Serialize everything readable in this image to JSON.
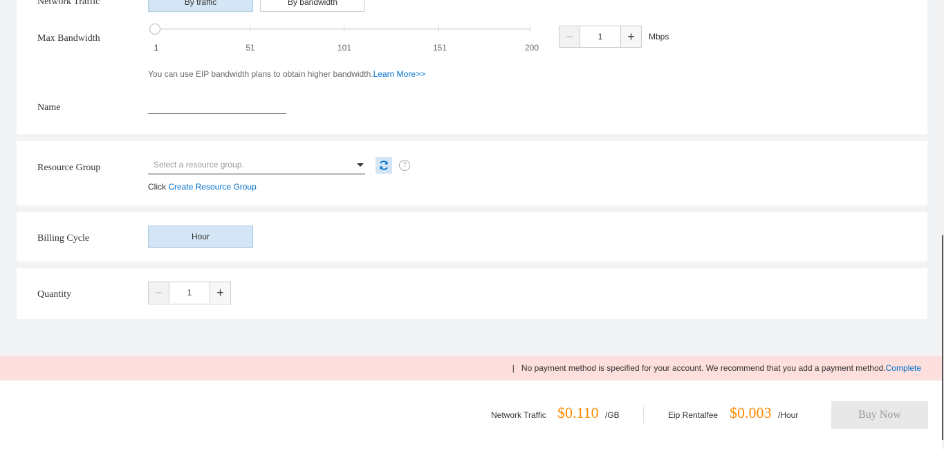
{
  "network": {
    "label": "Network Traffic",
    "options": [
      "By traffic",
      "By bandwidth"
    ]
  },
  "bandwidth": {
    "label": "Max Bandwidth",
    "ticks": [
      "1",
      "51",
      "101",
      "151",
      "200"
    ],
    "value": "1",
    "unit": "Mbps",
    "hint": "You can use EIP bandwidth plans to obtain higher bandwidth.",
    "learn_more": "Learn More>>"
  },
  "name": {
    "label": "Name",
    "value": ""
  },
  "resource_group": {
    "label": "Resource Group",
    "placeholder": "Select a resource group.",
    "click_text": "Click",
    "create_link": "Create Resource Group"
  },
  "billing": {
    "label": "Billing Cycle",
    "option": "Hour"
  },
  "quantity": {
    "label": "Quantity",
    "value": "1"
  },
  "notice": {
    "separator": "|",
    "text": "No payment method is specified for your account. We recommend that you add a payment method.",
    "link": "Complete"
  },
  "footer": {
    "traffic_label": "Network Traffic",
    "traffic_price": "$0.110",
    "traffic_unit": "/GB",
    "rental_label": "Eip Rentalfee",
    "rental_price": "$0.003",
    "rental_unit": "/Hour",
    "buy_button": "Buy Now"
  },
  "colors": {
    "accent": "#0070cc",
    "price": "#ff8a00",
    "notice_bg": "#fde0de",
    "selected_bg": "#d4e6f5"
  }
}
